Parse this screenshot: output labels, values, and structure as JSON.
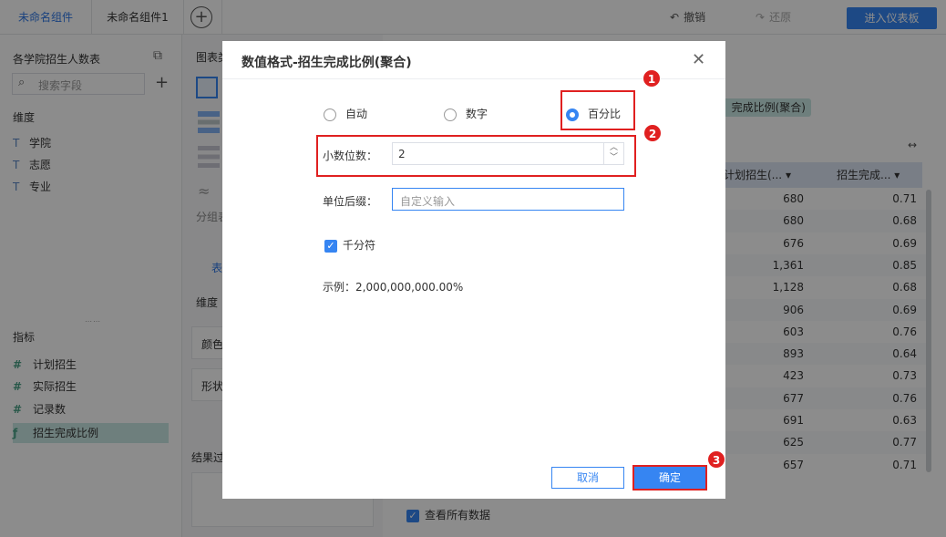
{
  "topbar": {
    "tabs": [
      "未命名组件",
      "未命名组件1"
    ],
    "undo_label": "撤销",
    "redo_label": "还原",
    "enter_dashboard_label": "进入仪表板"
  },
  "data_panel": {
    "dataset_title": "各学院招生人数表",
    "search_placeholder": "搜索字段",
    "dimension_title": "维度",
    "dimensions": [
      "学院",
      "志愿",
      "专业"
    ],
    "measure_title": "指标",
    "measures": [
      "计划招生",
      "实际招生",
      "记录数",
      "招生完成比例"
    ]
  },
  "middle_panel": {
    "chart_type_label": "图表类",
    "group_label": "分组表",
    "table_tab": "表",
    "dim_label": "维度",
    "color_label": "颜色",
    "shape_label": "形状",
    "result_filter_label": "结果过"
  },
  "table": {
    "pill_label": "完成比例(聚合)",
    "headers": [
      "计划招生(...",
      "招生完成..."
    ],
    "rows": [
      [
        "680",
        "0.71"
      ],
      [
        "680",
        "0.68"
      ],
      [
        "676",
        "0.69"
      ],
      [
        "1,361",
        "0.85"
      ],
      [
        "1,128",
        "0.68"
      ],
      [
        "906",
        "0.69"
      ],
      [
        "603",
        "0.76"
      ],
      [
        "893",
        "0.64"
      ],
      [
        "423",
        "0.73"
      ],
      [
        "677",
        "0.76"
      ],
      [
        "691",
        "0.63"
      ],
      [
        "625",
        "0.77"
      ],
      [
        "657",
        "0.71"
      ]
    ],
    "view_all_label": "查看所有数据"
  },
  "dialog": {
    "title": "数值格式-招生完成比例(聚合)",
    "radio_auto": "自动",
    "radio_number": "数字",
    "radio_percent": "百分比",
    "decimal_label": "小数位数：",
    "decimal_value": "2",
    "unit_suffix_label": "单位后缀：",
    "unit_suffix_placeholder": "自定义输入",
    "thousands_label": "千分符",
    "example_text": "示例：2,000,000,000.00%",
    "cancel_label": "取消",
    "ok_label": "确定"
  },
  "annotations": [
    "1",
    "2",
    "3"
  ],
  "colors": {
    "accent": "#3685f2",
    "annotation": "#e02020",
    "measure_highlight": "#c9e8e4"
  }
}
